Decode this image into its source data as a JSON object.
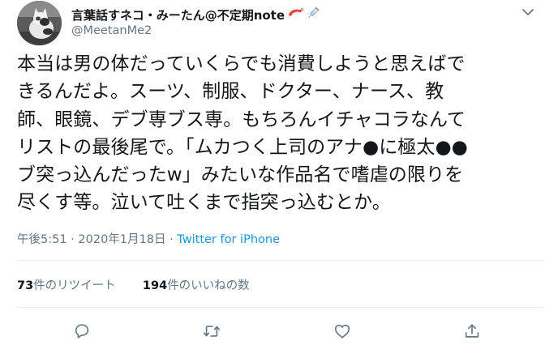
{
  "tweet": {
    "author": {
      "display_name": "言葉話すネコ・みーたん@不定期note",
      "handle": "@MeetanMe2"
    },
    "text_lines": [
      "本当は男の体だっていくらでも消費しようと思えばで",
      "きるんだよ。スーツ、制服、ドクター、ナース、教",
      "師、眼鏡、デブ専ブス専。もちろんイチャコラなんて",
      "リストの最後尾で。「ムカつく上司のアナ●に極太●●",
      "ブ突っ込んだったw」みたいな作品名で嗜虐の限りを",
      "尽くす等。泣いて吐くまで指突っ込むとか。"
    ],
    "time": "午後5:51",
    "separator": "·",
    "date": "2020年1月18日",
    "source": "Twitter for iPhone",
    "stats": {
      "retweets_count": "73",
      "retweets_label": "件のリツイート",
      "likes_count": "194",
      "likes_label": "件のいいねの数"
    }
  },
  "icons": {
    "name_emojis": [
      "shrimp-icon",
      "syringe-icon"
    ],
    "menu": "chevron-down-icon",
    "actions": [
      "reply-icon",
      "retweet-icon",
      "like-icon",
      "share-icon"
    ]
  },
  "colors": {
    "text": "#14171a",
    "secondary": "#657786",
    "link": "#1b95e0",
    "divider": "#e6ecf0",
    "icon": "#657786"
  }
}
